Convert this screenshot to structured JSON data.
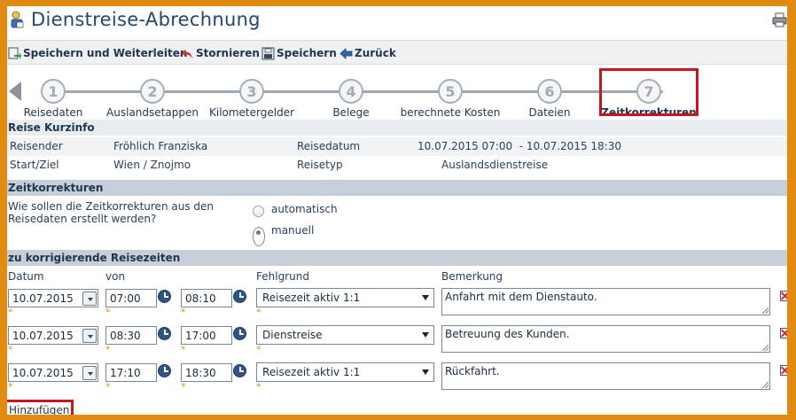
{
  "title": "Dienstreise-Abrechnung",
  "toolbar": {
    "save_forward": "Speichern und Weiterleiten",
    "cancel": "Stornieren",
    "save": "Speichern",
    "back": "Zurück"
  },
  "steps": [
    {
      "num": "1",
      "label": "Reisedaten"
    },
    {
      "num": "2",
      "label": "Auslandsetappen"
    },
    {
      "num": "3",
      "label": "Kilometergelder"
    },
    {
      "num": "4",
      "label": "Belege"
    },
    {
      "num": "5",
      "label": "berechnete Kosten"
    },
    {
      "num": "6",
      "label": "Dateien"
    },
    {
      "num": "7",
      "label": "Zeitkorrekturen"
    }
  ],
  "kurzinfo": {
    "heading": "Reise Kurzinfo",
    "reisender_label": "Reisender",
    "reisender_value": "Fröhlich Franziska",
    "reisedatum_label": "Reisedatum",
    "reisedatum_value": "10.07.2015 07:00  - 10.07.2015 18:30",
    "startziel_label": "Start/Ziel",
    "startziel_value": "Wien / Znojmo",
    "reisetyp_label": "Reisetyp",
    "reisetyp_value": "Auslandsdienstreise"
  },
  "zeitkorrekturen": {
    "heading": "Zeitkorrekturen",
    "question": "Wie sollen die Zeitkorrekturen aus den Reisedaten erstellt werden?",
    "option_auto": "automatisch",
    "option_manual": "manuell",
    "selected": "manuell"
  },
  "reisezeiten": {
    "heading": "zu korrigierende Reisezeiten",
    "columns": {
      "datum": "Datum",
      "von": "von",
      "fehlgrund": "Fehlgrund",
      "bemerkung": "Bemerkung"
    },
    "required_mark": "*",
    "rows": [
      {
        "datum": "10.07.2015",
        "von": "07:00",
        "bis": "08:10",
        "fehlgrund": "Reisezeit aktiv 1:1",
        "bemerkung": "Anfahrt mit dem Dienstauto."
      },
      {
        "datum": "10.07.2015",
        "von": "08:30",
        "bis": "17:00",
        "fehlgrund": "Dienstreise",
        "bemerkung": "Betreuung des Kunden."
      },
      {
        "datum": "10.07.2015",
        "von": "17:10",
        "bis": "18:30",
        "fehlgrund": "Reisezeit aktiv 1:1",
        "bemerkung": "Rückfahrt."
      }
    ],
    "add_label": "Hinzufügen"
  },
  "colors": {
    "accent_frame": "#e08a12",
    "highlight_box": "#c4161c",
    "section_header": "#c6cfd7"
  }
}
